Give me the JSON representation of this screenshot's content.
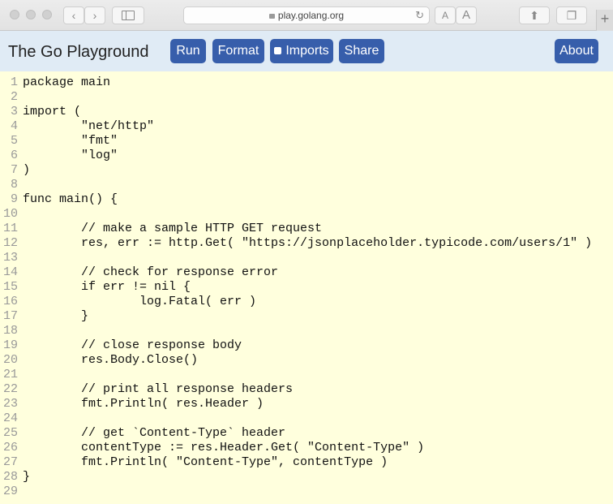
{
  "browser": {
    "url": "play.golang.org",
    "back_icon": "chevron-left",
    "forward_icon": "chevron-right",
    "text_small": "A",
    "text_large": "A",
    "new_tab": "+"
  },
  "header": {
    "title": "The Go Playground",
    "run_label": "Run",
    "format_label": "Format",
    "imports_label": "Imports",
    "share_label": "Share",
    "about_label": "About",
    "accent_color": "#375eab",
    "header_bg": "#e0ebf5"
  },
  "editor": {
    "background": "#ffffdd",
    "lines": [
      {
        "num": "1",
        "text": "package main"
      },
      {
        "num": "2",
        "text": ""
      },
      {
        "num": "3",
        "text": "import ("
      },
      {
        "num": "4",
        "text": "        \"net/http\""
      },
      {
        "num": "5",
        "text": "        \"fmt\""
      },
      {
        "num": "6",
        "text": "        \"log\""
      },
      {
        "num": "7",
        "text": ")"
      },
      {
        "num": "8",
        "text": ""
      },
      {
        "num": "9",
        "text": "func main() {"
      },
      {
        "num": "10",
        "text": ""
      },
      {
        "num": "11",
        "text": "        // make a sample HTTP GET request"
      },
      {
        "num": "12",
        "text": "        res, err := http.Get( \"https://jsonplaceholder.typicode.com/users/1\" )"
      },
      {
        "num": "13",
        "text": ""
      },
      {
        "num": "14",
        "text": "        // check for response error"
      },
      {
        "num": "15",
        "text": "        if err != nil {"
      },
      {
        "num": "16",
        "text": "                log.Fatal( err )"
      },
      {
        "num": "17",
        "text": "        }"
      },
      {
        "num": "18",
        "text": ""
      },
      {
        "num": "19",
        "text": "        // close response body"
      },
      {
        "num": "20",
        "text": "        res.Body.Close()"
      },
      {
        "num": "21",
        "text": ""
      },
      {
        "num": "22",
        "text": "        // print all response headers"
      },
      {
        "num": "23",
        "text": "        fmt.Println( res.Header )"
      },
      {
        "num": "24",
        "text": ""
      },
      {
        "num": "25",
        "text": "        // get `Content-Type` header"
      },
      {
        "num": "26",
        "text": "        contentType := res.Header.Get( \"Content-Type\" )"
      },
      {
        "num": "27",
        "text": "        fmt.Println( \"Content-Type\", contentType )"
      },
      {
        "num": "28",
        "text": "}"
      },
      {
        "num": "29",
        "text": ""
      }
    ]
  }
}
